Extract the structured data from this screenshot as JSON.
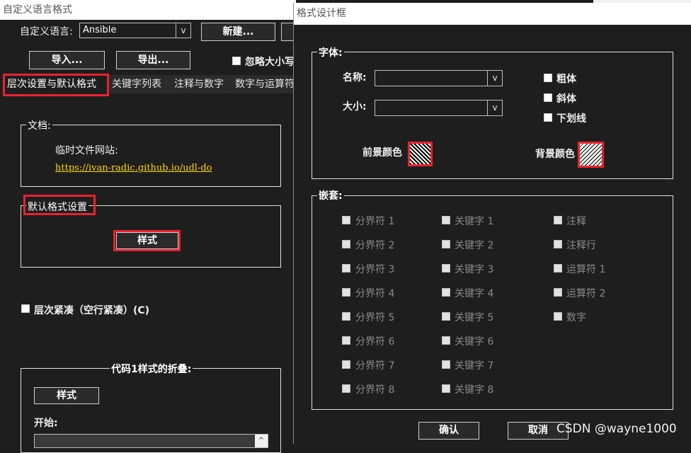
{
  "left_window": {
    "title": "自定义语言格式",
    "lang_label": "自定义语言:",
    "lang_value": "Ansible",
    "new_button": "新建...",
    "import_button": "导入...",
    "export_button": "导出...",
    "ignore_case": "忽略大小写",
    "tabs": [
      "层次设置与默认格式",
      "关键字列表",
      "注释与数字",
      "数字与运算符"
    ],
    "doc_group": "文档:",
    "temp_site_label": "临时文件网站:",
    "url": "https://ivan-radic.github.io/udl-do",
    "default_group": "默认格式设置",
    "style_button": "样式",
    "compact_label": "层次紧凑（空行紧凑）(C)",
    "fold_group": "代码1样式的折叠:",
    "fold_style_button": "样式",
    "start_label": "开始:"
  },
  "dialog": {
    "title": "格式设计框",
    "font_group": "字体:",
    "name_label": "名称:",
    "size_label": "大小:",
    "bold": "粗体",
    "italic": "斜体",
    "underline": "下划线",
    "fg_color": "前景颜色",
    "bg_color": "背景颜色",
    "nest_group": "嵌套:",
    "delimiters": [
      "分界符 1",
      "分界符 2",
      "分界符 3",
      "分界符 4",
      "分界符 5",
      "分界符 6",
      "分界符 7",
      "分界符 8"
    ],
    "keywords": [
      "关键字 1",
      "关键字 2",
      "关键字 3",
      "关键字 4",
      "关键字 5",
      "关键字 6",
      "关键字 7",
      "关键字 8"
    ],
    "others": [
      "注释",
      "注释行",
      "运算符 1",
      "运算符 2",
      "数字"
    ],
    "ok_button": "确认",
    "cancel_button": "取消"
  },
  "watermark": "CSDN @wayne1000",
  "colors": {
    "highlight": "#e8232f",
    "link": "#ffd700",
    "background": "#1e1e1e"
  }
}
